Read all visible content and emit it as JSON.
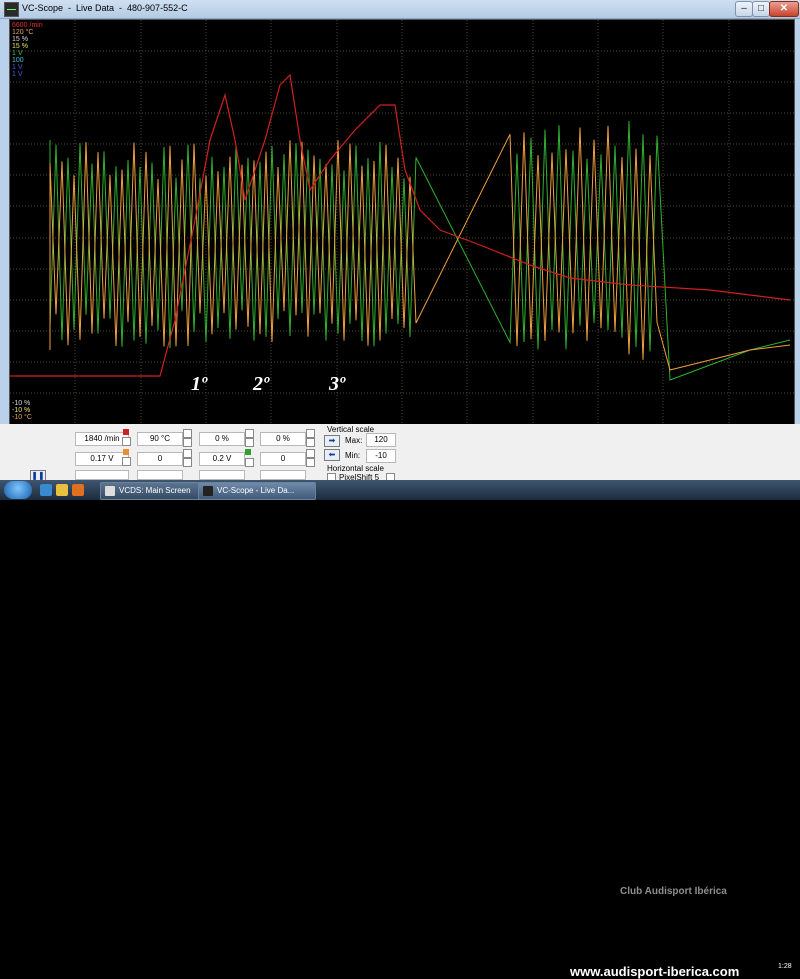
{
  "window": {
    "title": "VC-Scope  -  Live Data  -  480-907-552-C",
    "controls": {
      "minimize": "–",
      "maximize": "□",
      "close": "✕"
    }
  },
  "scope": {
    "top_labels": [
      {
        "text": "6600 /min",
        "color": "#e03030"
      },
      {
        "text": "120 °C",
        "color": "#e8a060"
      },
      {
        "text": "15 %",
        "color": "#d8d8d8"
      },
      {
        "text": "15 %",
        "color": "#e8e060"
      },
      {
        "text": "1 V",
        "color": "#40c040"
      },
      {
        "text": "100",
        "color": "#40c0e0"
      },
      {
        "text": "1 V",
        "color": "#4060e0"
      },
      {
        "text": "1 V",
        "color": "#4060e0"
      }
    ],
    "bottom_labels": [
      {
        "text": "-10 %",
        "color": "#d8d8d8"
      },
      {
        "text": "-10 %",
        "color": "#e8e060"
      },
      {
        "text": "-10 °C",
        "color": "#e8a060"
      }
    ],
    "annotations": [
      "1º",
      "2º",
      "3º"
    ],
    "colors": {
      "rpm": "#d02020",
      "lambda1": "#f0a040",
      "lambda2": "#30b030",
      "grid": "#4a4a22",
      "background": "#000000"
    }
  },
  "controls": {
    "row1": {
      "val1": "1840 /min",
      "val2": "90 °C",
      "val3": "0 %",
      "val4": "0 %"
    },
    "row2": {
      "val1": "0.17 V",
      "val2": "0",
      "val3": "0.2 V",
      "val4": "0"
    },
    "vertical_scale": {
      "title": "Vertical scale",
      "max_label": "Max:",
      "max_value": "120",
      "min_label": "Min:",
      "min_value": "-10"
    },
    "horizontal_scale": {
      "title": "Horizontal scale",
      "pixelshift_label": "PixelShift 5"
    },
    "pause_icon": "pause-icon"
  },
  "taskbar": {
    "tasks": [
      {
        "label": "VCDS:  Main Screen"
      },
      {
        "label": "VC-Scope  -  Live Da..."
      }
    ],
    "clock": "1:28"
  },
  "watermark": {
    "url": "www.audisport-iberica.com",
    "club": "Club Audisport Ibérica"
  }
}
